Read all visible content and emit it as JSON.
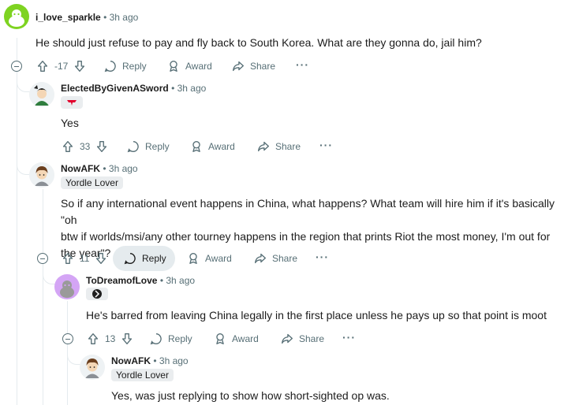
{
  "comments": [
    {
      "username": "i_love_sparkle",
      "time": "3h ago",
      "body": "He should just refuse to pay and fly back to South Korea. What are they gonna do, jail him?",
      "score": "-17"
    },
    {
      "username": "ElectedByGivenASword",
      "time": "3h ago",
      "body": "Yes",
      "score": "33"
    },
    {
      "username": "NowAFK",
      "time": "3h ago",
      "flair": "Yordle Lover",
      "body_lines": [
        "So if any international event happens in China, what happens? What team will hire him if it's basically \"oh",
        "btw if worlds/msi/any other tourney happens in the region that prints Riot the most money, I'm out for",
        "the year\"?"
      ],
      "score": "11"
    },
    {
      "username": "ToDreamofLove",
      "time": "3h ago",
      "body": "He's barred from leaving China legally in the first place unless he pays up so that point is moot",
      "score": "13"
    },
    {
      "username": "NowAFK",
      "time": "3h ago",
      "flair": "Yordle Lover",
      "body": "Yes, was just replying to show how short-sighted op was."
    }
  ],
  "actions": {
    "reply": "Reply",
    "award": "Award",
    "share": "Share",
    "more": "···"
  },
  "separator": "•",
  "colors": {
    "meta": "#576f76",
    "flair_bg": "#eaedef",
    "reply_active_bg": "#e5ebee",
    "avatar1": "#7ed321",
    "avatar4": "#d4a5f5"
  },
  "icons": [
    "upvote-icon",
    "downvote-icon",
    "reply-icon",
    "award-icon",
    "share-icon",
    "collapse-icon",
    "more-icon"
  ]
}
